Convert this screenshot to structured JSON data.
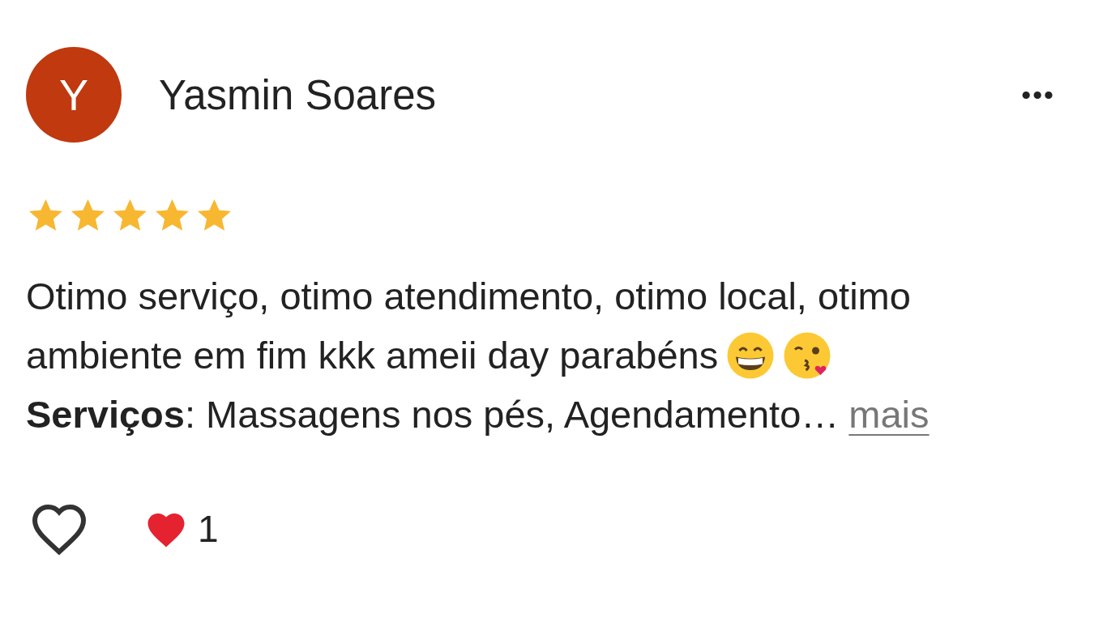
{
  "review": {
    "avatar": {
      "letter": "Y",
      "color": "#c0390f"
    },
    "author": "Yasmin Soares",
    "menu": "•••",
    "stars": 5,
    "text_lines": [
      "Otimo serviço, otimo atendimento, otimo local, otimo",
      "ambiente em fim kkk ameii day parabéns"
    ],
    "services": "**Serviços**: Massagens nos pés, Agendamento…",
    "more_link": "mais",
    "liked": false,
    "reaction_count": "1"
  }
}
